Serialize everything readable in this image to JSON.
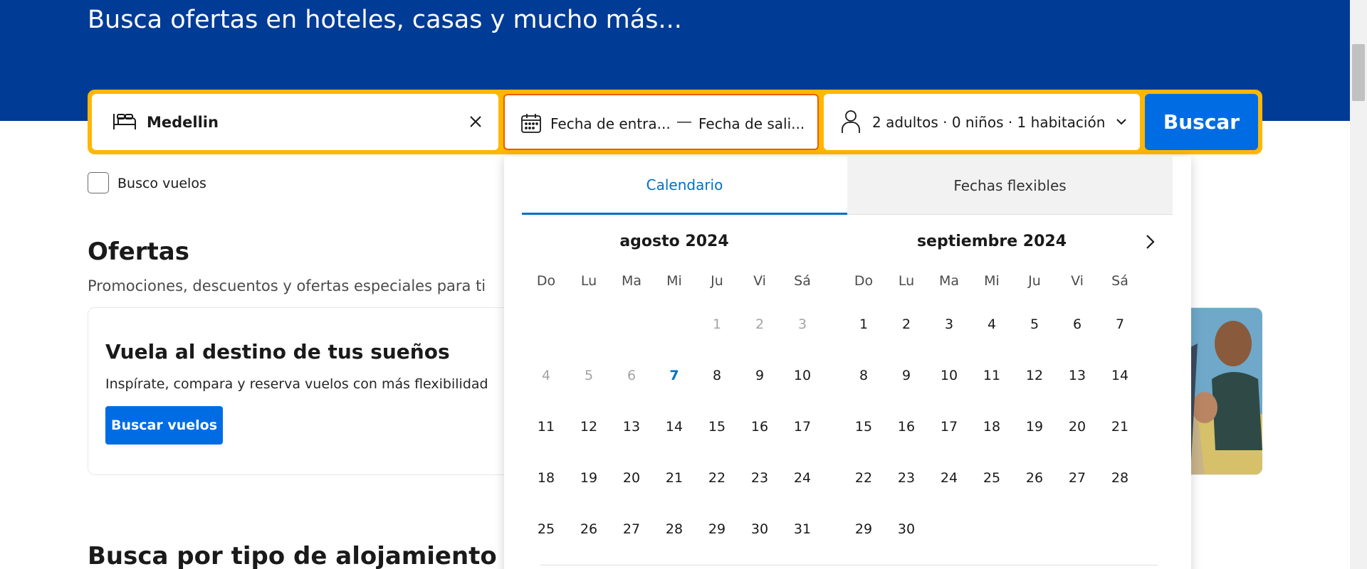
{
  "hero": {
    "title": "Busca ofertas en hoteles, casas y mucho más..."
  },
  "search": {
    "destination_value": "Medellin",
    "checkin_placeholder": "Fecha de entra...",
    "separator": "—",
    "checkout_placeholder": "Fecha de sali...",
    "guests_value": "2 adultos · 0 niños · 1 habitación",
    "submit_label": "Buscar"
  },
  "flights_checkbox": {
    "label": "Busco vuelos",
    "checked": false
  },
  "offers": {
    "title": "Ofertas",
    "subtitle": "Promociones, descuentos y ofertas especiales para ti",
    "card": {
      "title": "Vuela al destino de tus sueños",
      "text": "Inspírate, compara y reserva vuelos con más flexibilidad",
      "button_label": "Buscar vuelos"
    }
  },
  "accommodation": {
    "title": "Busca por tipo de alojamiento"
  },
  "calendar": {
    "tabs": [
      {
        "label": "Calendario",
        "active": true
      },
      {
        "label": "Fechas flexibles",
        "active": false
      }
    ],
    "weekdays": [
      "Do",
      "Lu",
      "Ma",
      "Mi",
      "Ju",
      "Vi",
      "Sá"
    ],
    "months": [
      {
        "title": "agosto 2024",
        "leading_blanks": 4,
        "days": 31,
        "past_until": 6,
        "today": 7
      },
      {
        "title": "septiembre 2024",
        "leading_blanks": 0,
        "days": 30,
        "past_until": 0,
        "today": null
      }
    ]
  },
  "colors": {
    "hero": "#003b95",
    "searchbar_border": "#ffb700",
    "primary": "#006ce4",
    "date_field_border": "#e95d00",
    "tab_active": "#0071c2"
  }
}
